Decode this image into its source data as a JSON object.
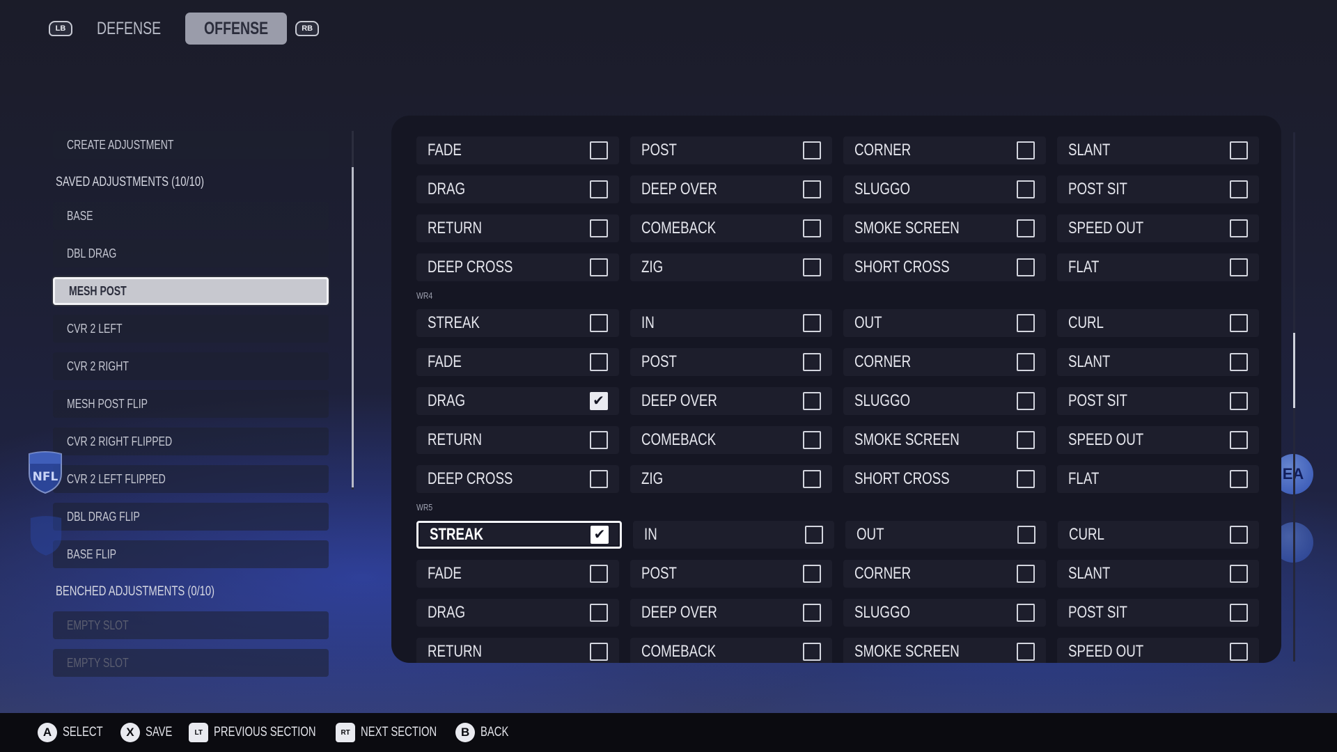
{
  "tabs": {
    "left_bumper": "LB",
    "right_bumper": "RB",
    "items": [
      {
        "label": "DEFENSE",
        "active": false
      },
      {
        "label": "OFFENSE",
        "active": true
      }
    ]
  },
  "left_panel": {
    "create": "CREATE ADJUSTMENT",
    "saved_header": "SAVED ADJUSTMENTS (10/10)",
    "saved": [
      "BASE",
      "DBL DRAG",
      "MESH POST",
      "CVR 2 LEFT",
      "CVR 2 RIGHT",
      "MESH POST FLIP",
      "CVR 2 RIGHT FLIPPED",
      "CVR 2 LEFT FLIPPED",
      "DBL DRAG FLIP",
      "BASE FLIP"
    ],
    "selected": "MESH POST",
    "benched_header": "BENCHED ADJUSTMENTS (0/10)",
    "benched": [
      "EMPTY SLOT",
      "EMPTY SLOT"
    ]
  },
  "routes": {
    "sections": [
      {
        "label": "",
        "rows": [
          [
            "FADE",
            "POST",
            "CORNER",
            "SLANT"
          ],
          [
            "DRAG",
            "DEEP OVER",
            "SLUGGO",
            "POST SIT"
          ],
          [
            "RETURN",
            "COMEBACK",
            "SMOKE SCREEN",
            "SPEED OUT"
          ],
          [
            "DEEP CROSS",
            "ZIG",
            "SHORT CROSS",
            "FLAT"
          ]
        ],
        "checked": []
      },
      {
        "label": "WR4",
        "rows": [
          [
            "STREAK",
            "IN",
            "OUT",
            "CURL"
          ],
          [
            "FADE",
            "POST",
            "CORNER",
            "SLANT"
          ],
          [
            "DRAG",
            "DEEP OVER",
            "SLUGGO",
            "POST SIT"
          ],
          [
            "RETURN",
            "COMEBACK",
            "SMOKE SCREEN",
            "SPEED OUT"
          ],
          [
            "DEEP CROSS",
            "ZIG",
            "SHORT CROSS",
            "FLAT"
          ]
        ],
        "checked": [
          "DRAG"
        ]
      },
      {
        "label": "WR5",
        "rows": [
          [
            "STREAK",
            "IN",
            "OUT",
            "CURL"
          ],
          [
            "FADE",
            "POST",
            "CORNER",
            "SLANT"
          ],
          [
            "DRAG",
            "DEEP OVER",
            "SLUGGO",
            "POST SIT"
          ],
          [
            "RETURN",
            "COMEBACK",
            "SMOKE SCREEN",
            "SPEED OUT"
          ]
        ],
        "checked": [
          "STREAK"
        ],
        "focused": "STREAK"
      }
    ]
  },
  "bottom_hints": [
    {
      "button": "A",
      "kind": "round",
      "label": "SELECT"
    },
    {
      "button": "X",
      "kind": "round",
      "label": "SAVE"
    },
    {
      "button": "LT",
      "kind": "trigger",
      "label": "PREVIOUS SECTION"
    },
    {
      "button": "RT",
      "kind": "trigger",
      "label": "NEXT SECTION"
    },
    {
      "button": "B",
      "kind": "round",
      "label": "BACK"
    }
  ],
  "logos": {
    "league": "NFL",
    "publisher": "EA"
  }
}
